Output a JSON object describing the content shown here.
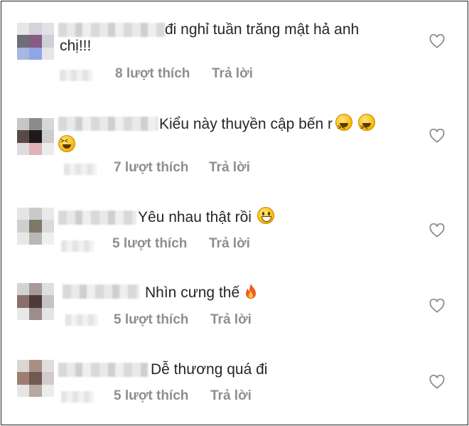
{
  "comments": [
    {
      "text_line1": "đi nghỉ tuần trăng mật hả anh",
      "text_line2": "chị!!!",
      "likes": "8 lượt thích",
      "reply": "Trả lời"
    },
    {
      "text_line1": "Kiểu này thuyền cập bến r",
      "likes": "7 lượt thích",
      "reply": "Trả lời"
    },
    {
      "text_line1": "Yêu nhau thật rồi",
      "likes": "5 lượt thích",
      "reply": "Trả lời"
    },
    {
      "text_line1": "Nhìn cưng thế",
      "likes": "5 lượt thích",
      "reply": "Trả lời"
    },
    {
      "text_line1": "Dễ thương quá đi",
      "likes": "5 lượt thích",
      "reply": "Trả lời"
    }
  ],
  "icons": {
    "like": "heart-outline-icon",
    "laugh_emoji": "grinning-squinting-face",
    "smile_emoji": "grinning-face",
    "fire_emoji": "fire"
  },
  "colors": {
    "text": "#262626",
    "meta": "#8e8e8e"
  }
}
